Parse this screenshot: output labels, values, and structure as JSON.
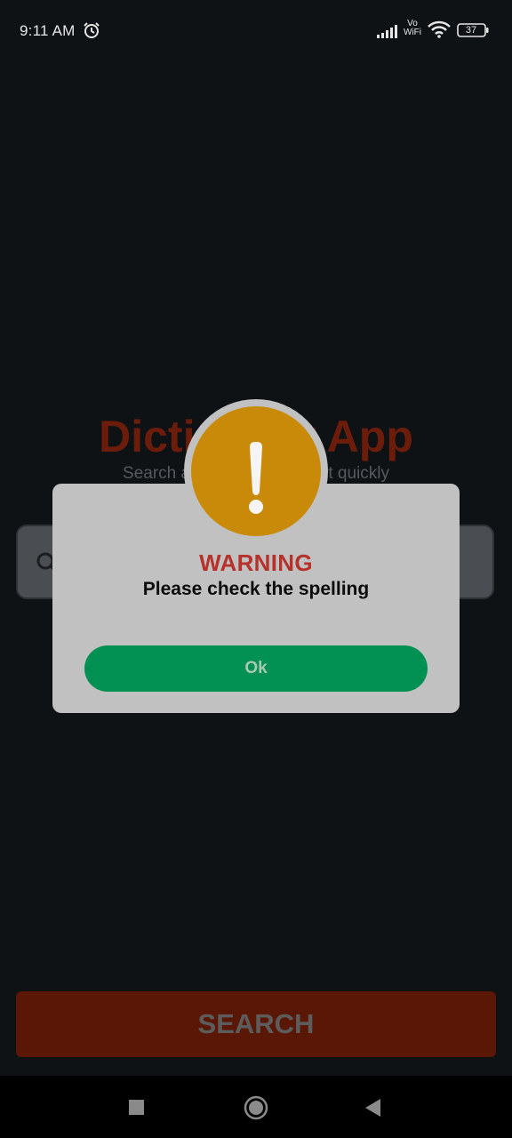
{
  "status_bar": {
    "time": "9:11 AM",
    "vowifi_line1": "Vo",
    "vowifi_line2": "WiFi",
    "battery_level": "37",
    "icons": [
      "alarm-icon",
      "signal-icon",
      "wifi-icon",
      "battery-icon"
    ]
  },
  "app": {
    "title": "Dictionary App",
    "subtitle": "Search a word meaning fast quickly",
    "search_button_label": "SEARCH"
  },
  "dialog": {
    "icon": "warning-exclamation-icon",
    "title": "WARNING",
    "message": "Please check the spelling",
    "ok_label": "Ok"
  },
  "nav_bar": {
    "icons": [
      "recents-square-icon",
      "home-circle-icon",
      "back-triangle-icon"
    ]
  },
  "colors": {
    "dialog_background": "#c1c1c1",
    "warning_icon": "#c88a08",
    "warning_title": "#b6312a",
    "ok_button": "#029152",
    "search_button_dimmed": "#5a1705"
  }
}
